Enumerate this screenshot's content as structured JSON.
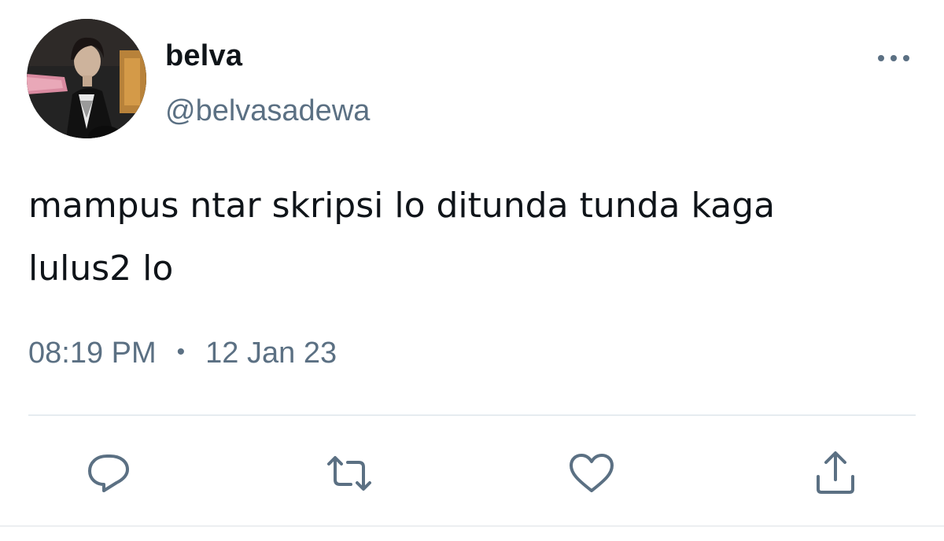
{
  "user": {
    "display_name": "belva",
    "handle": "@belvasadewa"
  },
  "tweet": {
    "text_line1": "mampus ntar skripsi lo ditunda tunda kaga",
    "text_line2": "lulus2 lo",
    "time": "08:19 PM",
    "separator": "•",
    "date": "12 Jan 23"
  },
  "icons": {
    "more": "more-horizontal-icon",
    "reply": "reply-icon",
    "retweet": "retweet-icon",
    "like": "heart-icon",
    "share": "share-icon"
  },
  "colors": {
    "primary_text": "#0f1419",
    "secondary_text": "#5b7083",
    "divider": "#e6ecf0"
  }
}
